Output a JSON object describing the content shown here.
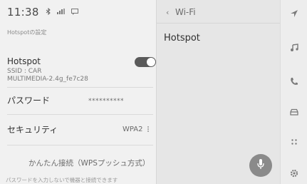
{
  "status": {
    "time": "11:38",
    "icons": [
      "bluetooth-icon",
      "signal-icon",
      "message-icon"
    ]
  },
  "left": {
    "section_title": "Hotspotの設定",
    "hotspot": {
      "label": "Hotspot",
      "ssid_line1": "SSID : CAR",
      "ssid_line2": "MULTIMEDIA-2.4g_fe7c28",
      "toggle_on": true
    },
    "password": {
      "label": "パスワード",
      "value": "**********"
    },
    "security": {
      "label": "セキュリティ",
      "value": "WPA2"
    },
    "wps": {
      "label": "かんたん接続（WPSプッシュ方式）",
      "note": "パスワードを入力しないで機器と接続できます"
    }
  },
  "right": {
    "back_label": "Wi-Fi",
    "item": "Hotspot"
  },
  "rail": [
    "navigation-icon",
    "music-icon",
    "phone-icon",
    "car-icon",
    "apps-icon",
    "settings-icon"
  ]
}
